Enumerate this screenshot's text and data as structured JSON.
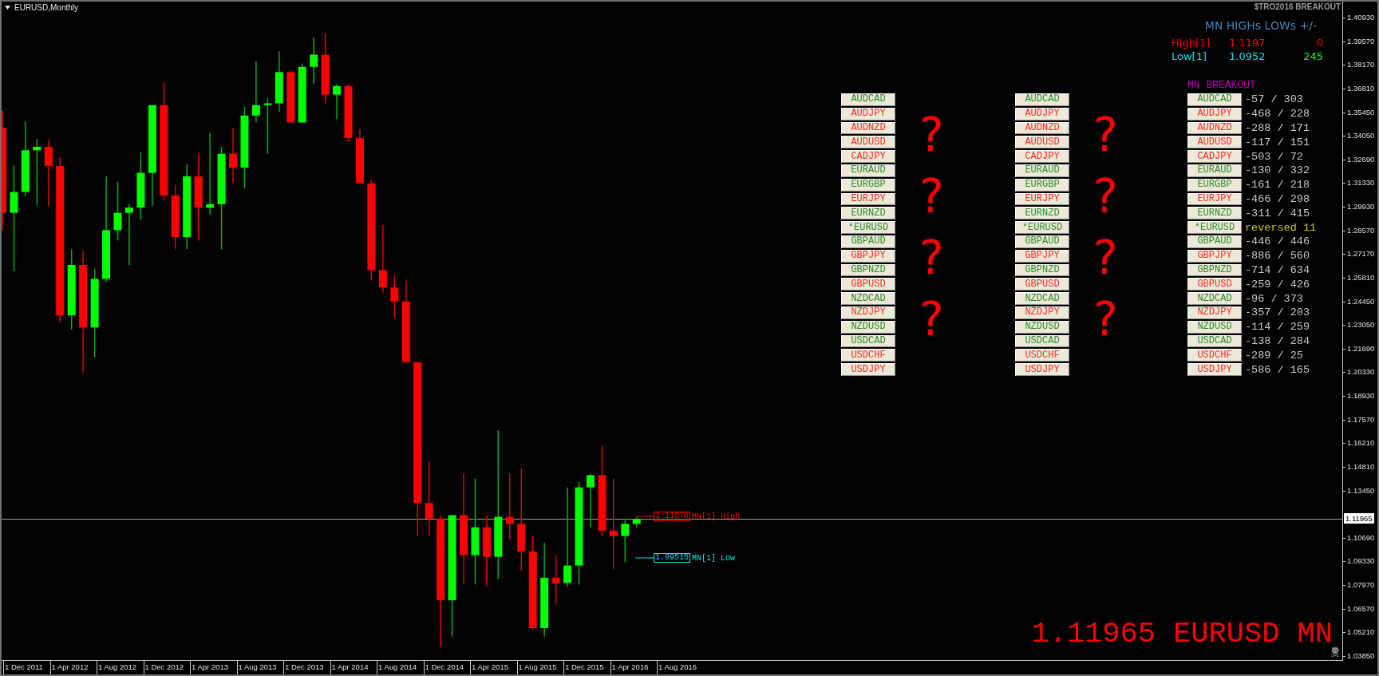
{
  "chart_window": {
    "title": "EURUSD,Monthly",
    "indicator_label": "$TRO2016 BREAKOUT"
  },
  "highs_lows": {
    "title": "MN HIGHs LOWs +/-",
    "rows": [
      {
        "kind": "high",
        "label": "High[1]",
        "value": "1.1197",
        "diff": "0"
      },
      {
        "kind": "low",
        "label": "Low[1]",
        "value": "1.0952",
        "diff": "245"
      }
    ]
  },
  "pair_columns": [
    {
      "pairs": [
        {
          "symbol": "AUDCAD",
          "color": "#2e8b2e"
        },
        {
          "symbol": "AUDJPY",
          "color": "#ff2a2a"
        },
        {
          "symbol": "AUDNZD",
          "color": "#ff2a2a"
        },
        {
          "symbol": "AUDUSD",
          "color": "#ff2a2a"
        },
        {
          "symbol": "CADJPY",
          "color": "#ff2a2a"
        },
        {
          "symbol": "EURAUD",
          "color": "#2e8b2e"
        },
        {
          "symbol": "EURGBP",
          "color": "#2e8b2e"
        },
        {
          "symbol": "EURJPY",
          "color": "#ff2a2a"
        },
        {
          "symbol": "EURNZD",
          "color": "#2e8b2e"
        },
        {
          "symbol": "*EURUSD",
          "color": "#2e8b2e"
        },
        {
          "symbol": "GBPAUD",
          "color": "#2e8b2e"
        },
        {
          "symbol": "GBPJPY",
          "color": "#ff2a2a"
        },
        {
          "symbol": "GBPNZD",
          "color": "#2e8b2e"
        },
        {
          "symbol": "GBPUSD",
          "color": "#ff2a2a"
        },
        {
          "symbol": "NZDCAD",
          "color": "#2e8b2e"
        },
        {
          "symbol": "NZDJPY",
          "color": "#ff2a2a"
        },
        {
          "symbol": "NZDUSD",
          "color": "#2e8b2e"
        },
        {
          "symbol": "USDCAD",
          "color": "#2e8b2e"
        },
        {
          "symbol": "USDCHF",
          "color": "#ff2a2a"
        },
        {
          "symbol": "USDJPY",
          "color": "#ff2a2a"
        }
      ],
      "question_marks": [
        "?",
        "?",
        "?",
        "?"
      ]
    },
    {
      "pairs": [
        {
          "symbol": "AUDCAD",
          "color": "#2e8b2e"
        },
        {
          "symbol": "AUDJPY",
          "color": "#ff2a2a"
        },
        {
          "symbol": "AUDNZD",
          "color": "#ff2a2a"
        },
        {
          "symbol": "AUDUSD",
          "color": "#ff2a2a"
        },
        {
          "symbol": "CADJPY",
          "color": "#ff2a2a"
        },
        {
          "symbol": "EURAUD",
          "color": "#2e8b2e"
        },
        {
          "symbol": "EURGBP",
          "color": "#2e8b2e"
        },
        {
          "symbol": "EURJPY",
          "color": "#ff2a2a"
        },
        {
          "symbol": "EURNZD",
          "color": "#2e8b2e"
        },
        {
          "symbol": "*EURUSD",
          "color": "#2e8b2e"
        },
        {
          "symbol": "GBPAUD",
          "color": "#2e8b2e"
        },
        {
          "symbol": "GBPJPY",
          "color": "#ff2a2a"
        },
        {
          "symbol": "GBPNZD",
          "color": "#2e8b2e"
        },
        {
          "symbol": "GBPUSD",
          "color": "#ff2a2a"
        },
        {
          "symbol": "NZDCAD",
          "color": "#2e8b2e"
        },
        {
          "symbol": "NZDJPY",
          "color": "#ff2a2a"
        },
        {
          "symbol": "NZDUSD",
          "color": "#2e8b2e"
        },
        {
          "symbol": "USDCAD",
          "color": "#2e8b2e"
        },
        {
          "symbol": "USDCHF",
          "color": "#ff2a2a"
        },
        {
          "symbol": "USDJPY",
          "color": "#ff2a2a"
        }
      ],
      "question_marks": [
        "?",
        "?",
        "?",
        "?"
      ]
    }
  ],
  "breakout": {
    "title": "MN BREAKOUT",
    "rows": [
      {
        "symbol": "AUDCAD",
        "color": "#2e8b2e",
        "kind": "range",
        "reading": "-57 / 303"
      },
      {
        "symbol": "AUDJPY",
        "color": "#ff2a2a",
        "kind": "range",
        "reading": "-468 / 228"
      },
      {
        "symbol": "AUDNZD",
        "color": "#ff2a2a",
        "kind": "range",
        "reading": "-288 / 171"
      },
      {
        "symbol": "AUDUSD",
        "color": "#ff2a2a",
        "kind": "range",
        "reading": "-117 / 151"
      },
      {
        "symbol": "CADJPY",
        "color": "#ff2a2a",
        "kind": "range",
        "reading": "-503 / 72"
      },
      {
        "symbol": "EURAUD",
        "color": "#2e8b2e",
        "kind": "range",
        "reading": "-130 / 332"
      },
      {
        "symbol": "EURGBP",
        "color": "#2e8b2e",
        "kind": "range",
        "reading": "-161 / 218"
      },
      {
        "symbol": "EURJPY",
        "color": "#ff2a2a",
        "kind": "range",
        "reading": "-466 / 298"
      },
      {
        "symbol": "EURNZD",
        "color": "#2e8b2e",
        "kind": "range",
        "reading": "-311 / 415"
      },
      {
        "symbol": "*EURUSD",
        "color": "#2e8b2e",
        "kind": "reversed",
        "reading": "reversed 11"
      },
      {
        "symbol": "GBPAUD",
        "color": "#2e8b2e",
        "kind": "range",
        "reading": "-446 / 446"
      },
      {
        "symbol": "GBPJPY",
        "color": "#ff2a2a",
        "kind": "range",
        "reading": "-886 / 560"
      },
      {
        "symbol": "GBPNZD",
        "color": "#2e8b2e",
        "kind": "range",
        "reading": "-714 / 634"
      },
      {
        "symbol": "GBPUSD",
        "color": "#ff2a2a",
        "kind": "range",
        "reading": "-259 / 426"
      },
      {
        "symbol": "NZDCAD",
        "color": "#2e8b2e",
        "kind": "range",
        "reading": "-96 / 373"
      },
      {
        "symbol": "NZDJPY",
        "color": "#ff2a2a",
        "kind": "range",
        "reading": "-357 / 203"
      },
      {
        "symbol": "NZDUSD",
        "color": "#2e8b2e",
        "kind": "range",
        "reading": "-114 / 259"
      },
      {
        "symbol": "USDCAD",
        "color": "#2e8b2e",
        "kind": "range",
        "reading": "-138 / 284"
      },
      {
        "symbol": "USDCHF",
        "color": "#ff2a2a",
        "kind": "range",
        "reading": "-289 / 25"
      },
      {
        "symbol": "USDJPY",
        "color": "#ff2a2a",
        "kind": "range",
        "reading": "-586 / 165"
      }
    ]
  },
  "level_labels": [
    {
      "kind": "high",
      "price": "1.11970",
      "label": "MN[1] High"
    },
    {
      "kind": "low",
      "price": "1.09515",
      "label": "MN[1] Low"
    }
  ],
  "price_banner": "1.11965 EURUSD MN",
  "price_axis": {
    "ticks": [
      "1.40930",
      "1.39570",
      "1.38170",
      "1.36810",
      "1.35450",
      "1.34050",
      "1.32690",
      "1.31330",
      "1.29930",
      "1.28570",
      "1.27170",
      "1.25810",
      "1.24450",
      "1.23050",
      "1.21690",
      "1.20330",
      "1.18930",
      "1.17570",
      "1.16210",
      "1.14810",
      "1.13450",
      "1.10690",
      "1.09330",
      "1.07970",
      "1.06570",
      "1.05210",
      "1.03850"
    ],
    "current": "1.11965"
  },
  "time_axis": {
    "ticks": [
      "1 Dec 2011",
      "1 Apr 2012",
      "1 Aug 2012",
      "1 Dec 2012",
      "1 Apr 2013",
      "1 Aug 2013",
      "1 Dec 2013",
      "1 Apr 2014",
      "1 Aug 2014",
      "1 Dec 2014",
      "1 Apr 2015",
      "1 Aug 2015",
      "1 Dec 2015",
      "1 Apr 2016",
      "1 Aug 2016"
    ]
  }
}
